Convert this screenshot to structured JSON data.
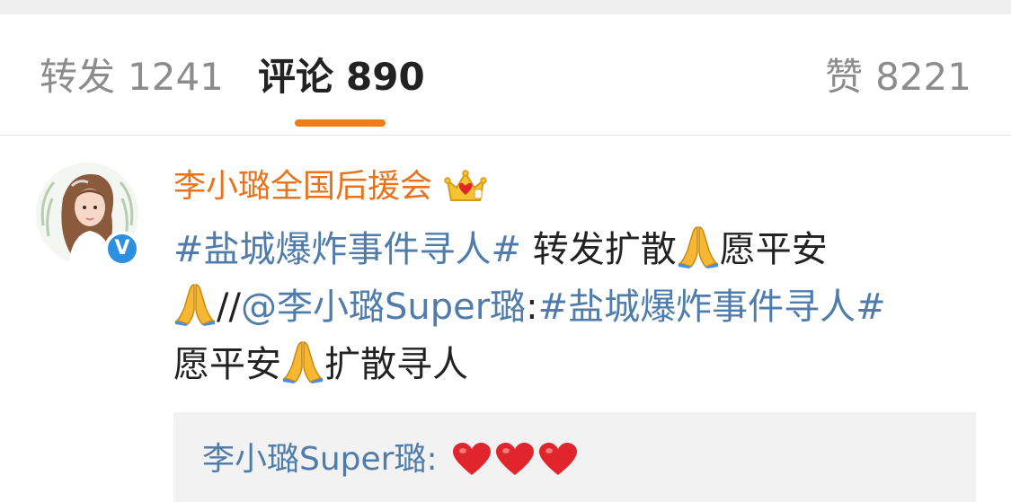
{
  "tabs": {
    "repost": {
      "label": "转发",
      "count": "1241"
    },
    "comments": {
      "label": "评论",
      "count": "890"
    },
    "likes": {
      "label": "赞",
      "count": "8221"
    }
  },
  "comment": {
    "username": "李小璐全国后援会",
    "verified_badge": "V",
    "badge_icon": "crown-icon",
    "text": {
      "topic_1": "#盐城爆炸事件寻人#",
      "t1": " 转发扩散",
      "t2": "愿平安",
      "t3": "//",
      "mention": "@李小璐Super璐",
      "colon": ":",
      "topic_2": "#盐城爆炸事件寻人#",
      "t4": "愿平安",
      "t5": "扩散寻人"
    },
    "reply": {
      "author": "李小璐Super璐",
      "sep": ": "
    }
  },
  "colors": {
    "accent": "#ef7d14",
    "username": "#e8731c",
    "link": "#4f7cab",
    "verified": "#2d8fe0",
    "heart": "#e0262c"
  }
}
